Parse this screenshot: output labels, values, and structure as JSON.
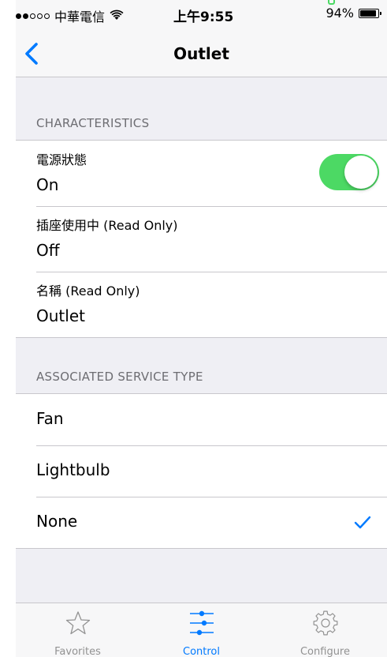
{
  "status_bar": {
    "carrier": "中華電信",
    "time": "上午9:55",
    "battery_percent": "94%",
    "battery_level": 0.94
  },
  "nav": {
    "title": "Outlet"
  },
  "characteristics": {
    "header": "CHARACTERISTICS",
    "rows": [
      {
        "title": "電源狀態",
        "value": "On",
        "toggle_on": true
      },
      {
        "title": "插座使用中 (Read Only)",
        "value": "Off"
      },
      {
        "title": "名稱 (Read Only)",
        "value": "Outlet"
      }
    ]
  },
  "service_type": {
    "header": "ASSOCIATED SERVICE TYPE",
    "options": [
      {
        "label": "Fan",
        "selected": false
      },
      {
        "label": "Lightbulb",
        "selected": false
      },
      {
        "label": "None",
        "selected": true
      }
    ]
  },
  "tab_bar": {
    "tabs": [
      {
        "label": "Favorites",
        "icon": "star-icon",
        "active": false
      },
      {
        "label": "Control",
        "icon": "sliders-icon",
        "active": true
      },
      {
        "label": "Configure",
        "icon": "gear-icon",
        "active": false
      }
    ]
  },
  "colors": {
    "accent": "#007aff",
    "toggle_on": "#4cd964",
    "background": "#efeff4"
  }
}
